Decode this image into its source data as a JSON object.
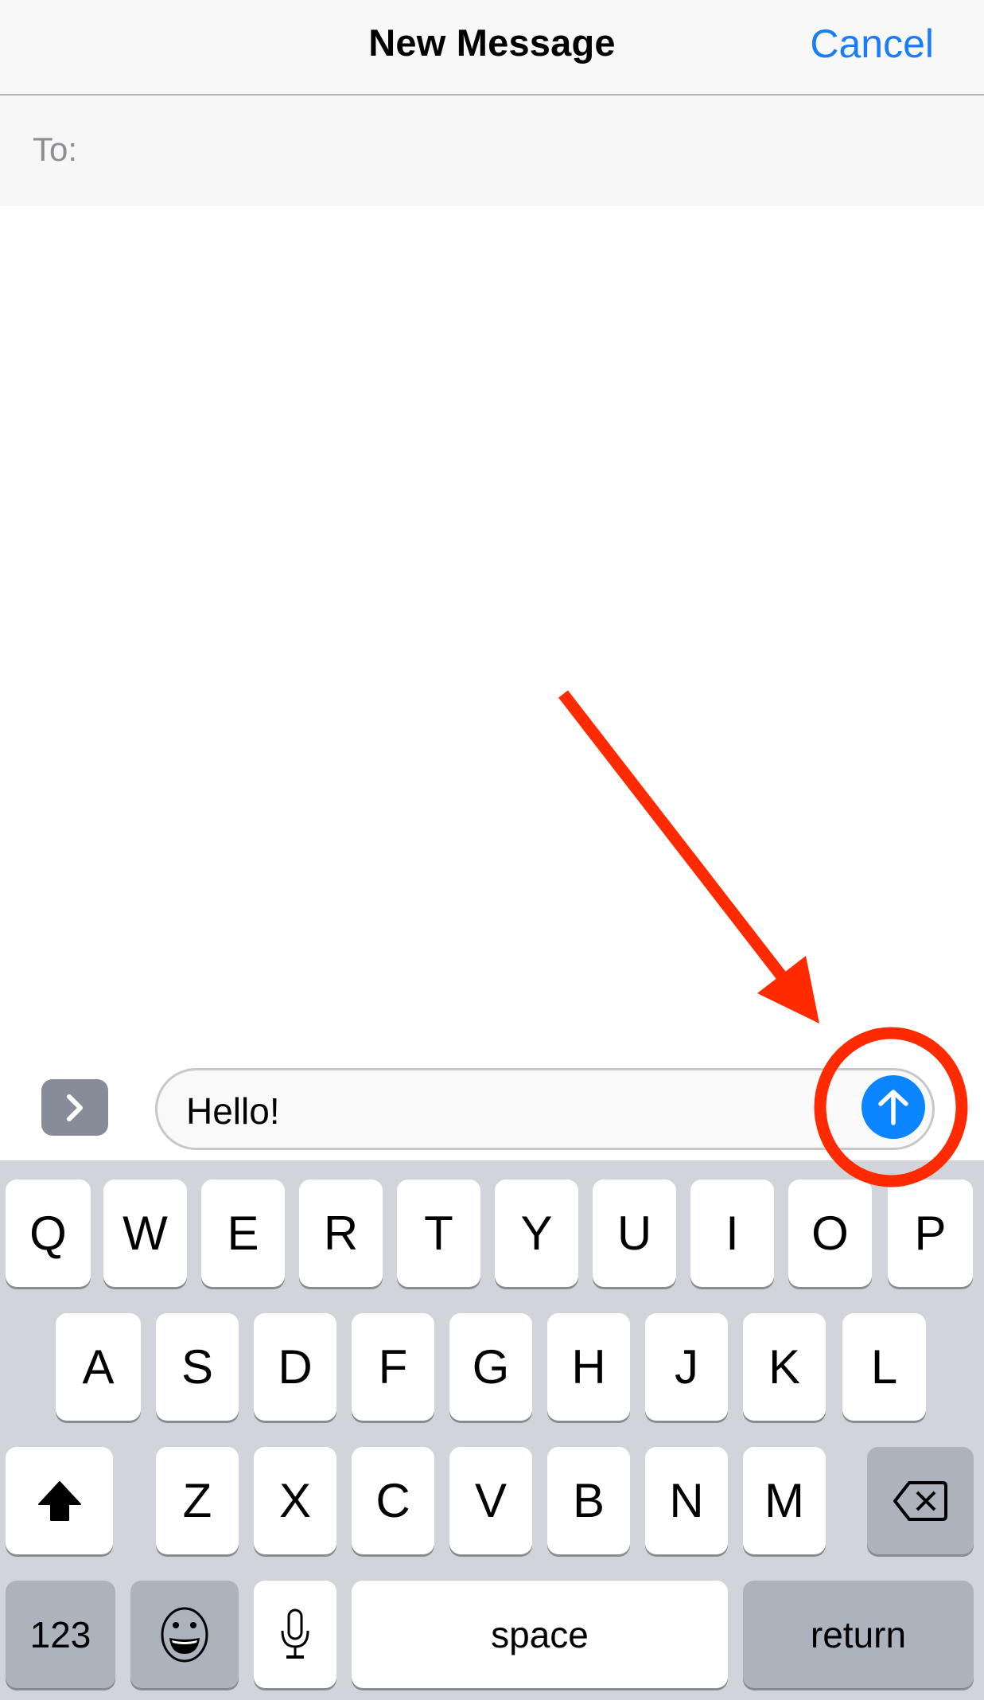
{
  "header": {
    "title": "New Message",
    "cancel_label": "Cancel"
  },
  "recipient": {
    "label": "To:",
    "value": ""
  },
  "composer": {
    "apps_button": "chevron-right-icon",
    "message_text": "Hello!",
    "send_button": "arrow-up-icon"
  },
  "keyboard": {
    "row1": [
      "Q",
      "W",
      "E",
      "R",
      "T",
      "Y",
      "U",
      "I",
      "O",
      "P"
    ],
    "row2": [
      "A",
      "S",
      "D",
      "F",
      "G",
      "H",
      "J",
      "K",
      "L"
    ],
    "row3": [
      "Z",
      "X",
      "C",
      "V",
      "B",
      "N",
      "M"
    ],
    "shift_icon": "shift-icon",
    "delete_icon": "delete-backspace-icon",
    "numbers_label": "123",
    "emoji_icon": "emoji-icon",
    "dictation_icon": "microphone-icon",
    "space_label": "space",
    "return_label": "return"
  },
  "annotation": {
    "type": "red arrow and circle highlighting send button",
    "color": "#ff2a00"
  },
  "colors": {
    "accent": "#1a7cf6",
    "send_button": "#0a84ff",
    "keyboard_bg": "#d1d4da",
    "special_key": "#acb3bc"
  }
}
